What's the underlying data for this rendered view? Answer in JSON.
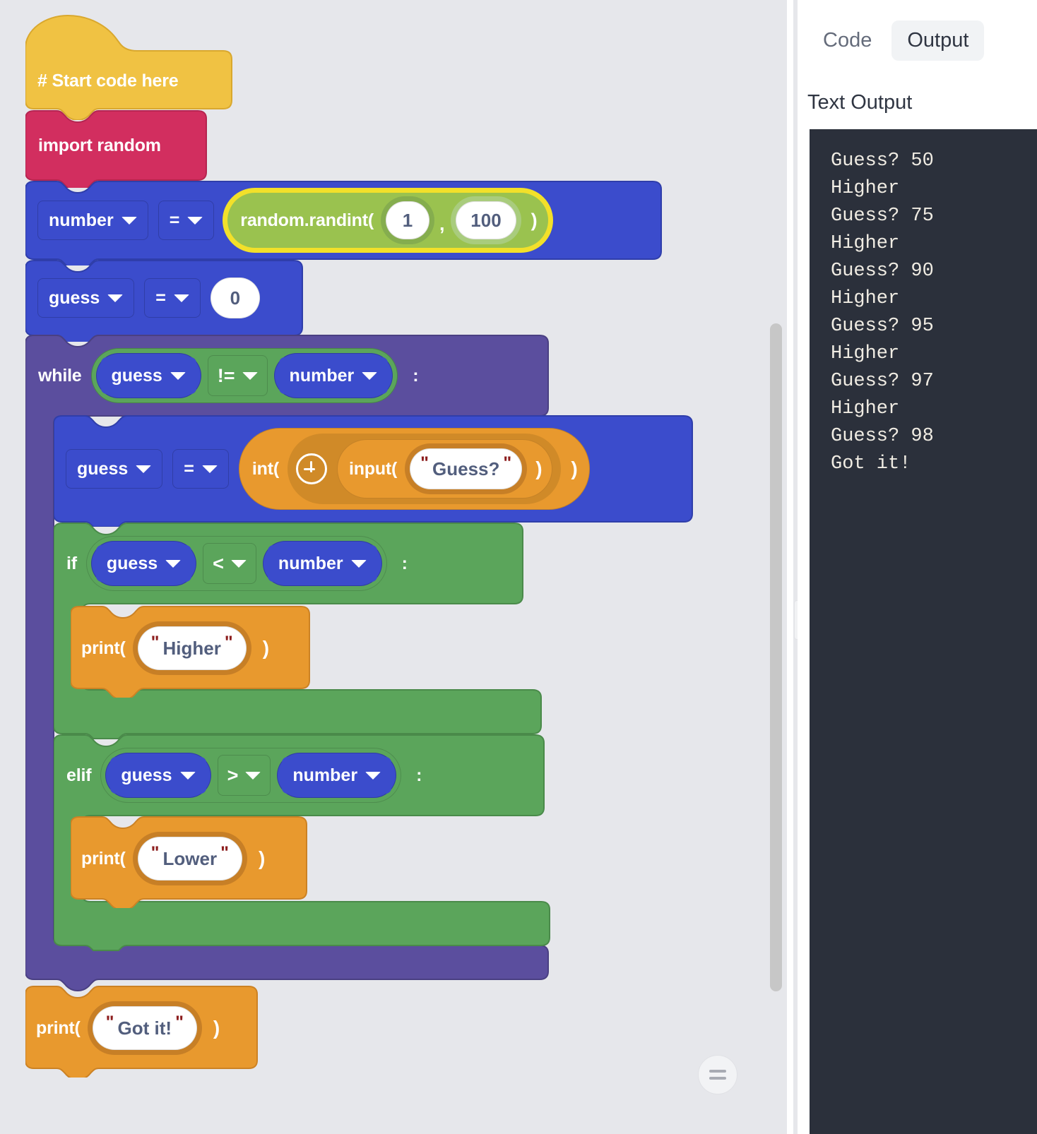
{
  "workspace": {
    "background_color": "#e6e7eb",
    "zoom_reset_label": "=",
    "blocks": {
      "hat": {
        "label": "# Start code here",
        "color": "#f0c243"
      },
      "import": {
        "label": "import random",
        "color": "#d22e5f"
      },
      "assign_number": {
        "var": "number",
        "op": "=",
        "value_block": {
          "name": "random.randint(",
          "arg1": "1",
          "comma": ",",
          "arg2": "100",
          "close": ")",
          "color": "#9ac24f",
          "selected": true
        },
        "color": "#3b4ccc"
      },
      "assign_guess_zero": {
        "var": "guess",
        "op": "=",
        "value": "0",
        "color": "#3b4ccc"
      },
      "while": {
        "keyword": "while",
        "left": "guess",
        "op": "!=",
        "right": "number",
        "colon": ":",
        "color": "#5b4e9e",
        "condition_color": "#5ba55b"
      },
      "assign_guess_input": {
        "var": "guess",
        "op": "=",
        "int_label": "int(",
        "plus_icon": "plus-circle-icon",
        "input_label": "input(",
        "prompt": "Guess?",
        "close_inner": ")",
        "close_outer": ")",
        "color": "#3b4ccc",
        "value_color": "#e8992e"
      },
      "if": {
        "keyword": "if",
        "left": "guess",
        "op": "<",
        "right": "number",
        "colon": ":",
        "color": "#5ba55b"
      },
      "print_higher": {
        "label": "print(",
        "text": "Higher",
        "close": ")",
        "color": "#e8992e"
      },
      "elif": {
        "keyword": "elif",
        "left": "guess",
        "op": ">",
        "right": "number",
        "colon": ":",
        "color": "#5ba55b"
      },
      "print_lower": {
        "label": "print(",
        "text": "Lower",
        "close": ")",
        "color": "#e8992e"
      },
      "print_gotit": {
        "label": "print(",
        "text": "Got it!",
        "close": ")",
        "color": "#e8992e"
      }
    }
  },
  "panel": {
    "tabs": [
      {
        "label": "Code",
        "active": false
      },
      {
        "label": "Output",
        "active": true
      }
    ],
    "title": "Text Output",
    "console_text": "Guess? 50\nHigher\nGuess? 75\nHigher\nGuess? 90\nHigher\nGuess? 95\nHigher\nGuess? 97\nHigher\nGuess? 98\nGot it!",
    "console_bg": "#2b303b",
    "console_fg": "#f0ece3"
  }
}
